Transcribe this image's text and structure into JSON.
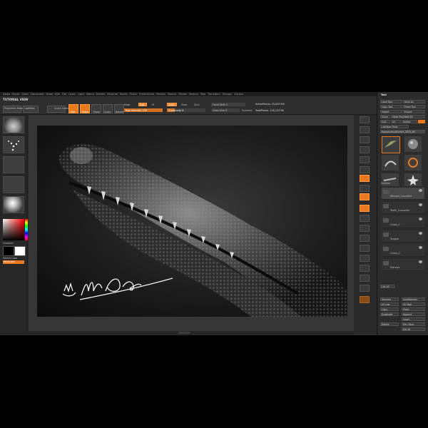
{
  "menu": [
    "Alpha",
    "Brush",
    "Color",
    "Document",
    "Draw",
    "Edit",
    "File",
    "Layer",
    "Light",
    "Macro",
    "Marker",
    "Material",
    "Movie",
    "Picker",
    "Preferences",
    "Render",
    "Stencil",
    "Stroke",
    "Texture",
    "Tool",
    "Transform",
    "Zplugin",
    "Zscript"
  ],
  "shelf": {
    "title": "TUTORIAL VIEW",
    "projection_label": "Projection Master",
    "lightbox_label": "LightBox",
    "quick_sketch_label": "Quick Sketch",
    "edit_label": "Edit",
    "draw_label": "Draw",
    "move_label": "Move",
    "scale_label": "Scale",
    "rotate_label": "Rotate",
    "mrgb_label": "Mrgb",
    "rgb_label": "Rgb",
    "m_label": "M",
    "zadd_label": "Zadd",
    "zsub_label": "Zsub",
    "zcut_label": "Zcut",
    "rgb_intensity_label": "Rgb Intensity 100",
    "z_intensity_label": "Z Intensity 8",
    "focal_shift_label": "Focal Shift 0",
    "draw_size_label": "Draw Size 8",
    "dynamic_label": "Dynamic",
    "active_points_label": "ActivePoints: 25,643 Mil",
    "total_points_label": "TotalPoints: 118,122 Mil"
  },
  "left_tray": {
    "alternate_label": "SwitchColor",
    "alternate_btn": "Alternate"
  },
  "signature": "MarcoPerellinus",
  "palette": {
    "title": "Tool",
    "load_tool": "Load Tool",
    "save_as": "Save As",
    "copy_tool": "Copy Tool",
    "paste_tool": "Paste Tool",
    "import": "Import",
    "export": "Export",
    "clone": "Clone",
    "make_polymesh": "Make PolyMesh3D",
    "goz": "GoZ",
    "all": "All",
    "visible": "Visible",
    "lightbox_tools": "Lightbox Tools",
    "current_tool": "SarcosuchusHunter_2019_48",
    "subtool_header": "Subtool",
    "subtools": [
      "Merged_Crocodile",
      "Teeth_Crocodile",
      "Gums_1",
      "Tongue",
      "Gums_2",
      "Kidneys"
    ],
    "list_all": "List All",
    "rename": "Rename",
    "auto_reorder": "AutoReorder",
    "all_low": "All Low",
    "all_high": "All High",
    "copy": "Copy",
    "paste": "Paste",
    "duplicate": "Duplicate",
    "append": "Append",
    "insert": "Insert",
    "delete": "Delete",
    "del_other": "Del Other",
    "del_all": "Del All"
  }
}
